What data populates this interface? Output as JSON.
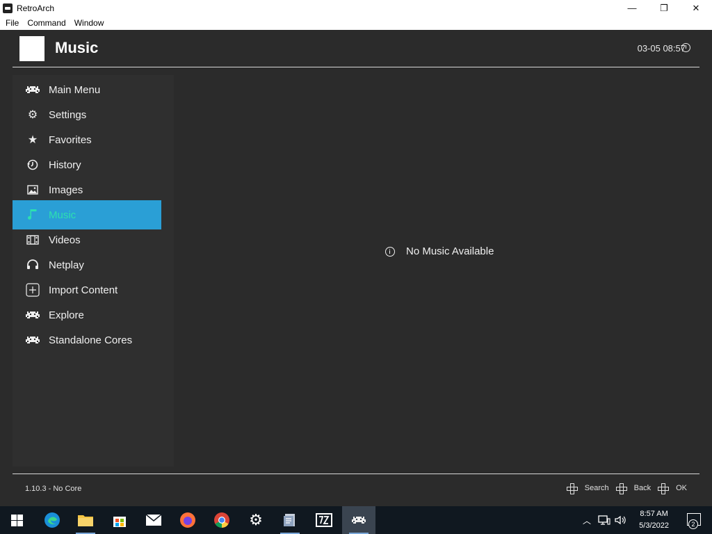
{
  "window": {
    "title": "RetroArch",
    "controls": {
      "minimize": "—",
      "restore": "❐",
      "close": "✕"
    }
  },
  "menubar": {
    "items": [
      "File",
      "Command",
      "Window"
    ]
  },
  "header": {
    "title": "Music",
    "clock": "03-05 08:57"
  },
  "sidebar": {
    "items": [
      {
        "label": "Main Menu",
        "icon": "invader-icon"
      },
      {
        "label": "Settings",
        "icon": "gear-icon"
      },
      {
        "label": "Favorites",
        "icon": "star-icon"
      },
      {
        "label": "History",
        "icon": "history-icon"
      },
      {
        "label": "Images",
        "icon": "image-icon"
      },
      {
        "label": "Music",
        "icon": "music-note-icon",
        "selected": true
      },
      {
        "label": "Videos",
        "icon": "film-icon"
      },
      {
        "label": "Netplay",
        "icon": "headset-icon"
      },
      {
        "label": "Import Content",
        "icon": "plus-box-icon"
      },
      {
        "label": "Explore",
        "icon": "invader-icon"
      },
      {
        "label": "Standalone Cores",
        "icon": "invader-icon"
      }
    ]
  },
  "content": {
    "empty_message": "No Music Available"
  },
  "footer": {
    "version": "1.10.3 - No Core",
    "hints": [
      {
        "label": "Search"
      },
      {
        "label": "Back"
      },
      {
        "label": "OK"
      }
    ]
  },
  "taskbar": {
    "time": "8:57 AM",
    "date": "5/3/2022",
    "notification_count": "2"
  },
  "colors": {
    "selection": "#2a9fd6",
    "selected_text": "#2de0b0",
    "background": "#2b2b2b"
  }
}
